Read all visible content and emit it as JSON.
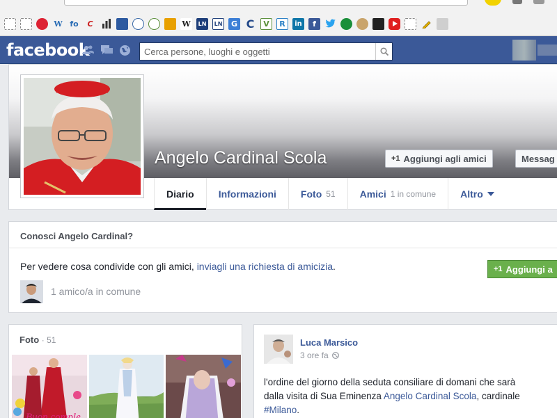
{
  "search": {
    "placeholder": "Cerca persone, luoghi e oggetti"
  },
  "facebook": {
    "logo": "facebook"
  },
  "bookmarks": [
    "W",
    "fo",
    "C",
    "W",
    "LN",
    "LN",
    "G",
    "C",
    "V",
    "R",
    "in",
    "f"
  ],
  "profile": {
    "name": "Angelo Cardinal Scola",
    "add_friend": "Aggiungi agli amici",
    "message": "Messag"
  },
  "tabs": [
    {
      "label": "Diario",
      "count": ""
    },
    {
      "label": "Informazioni",
      "count": ""
    },
    {
      "label": "Foto",
      "count": "51"
    },
    {
      "label": "Amici",
      "count": "1 in comune"
    },
    {
      "label": "Altro",
      "count": ""
    }
  ],
  "know": {
    "title": "Conosci Angelo Cardinal?",
    "text_prefix": "Per vedere cosa condivide con gli amici, ",
    "link": "inviagli una richiesta di amicizia",
    "text_suffix": ".",
    "button": "Aggiungi a",
    "mutual": "1 amico/a in comune"
  },
  "photos": {
    "title": "Foto",
    "count": "51",
    "caption_partial": "Buon comple"
  },
  "post": {
    "author": "Luca Marsico",
    "time": "3 ore fa",
    "line1": "l'ordine del giorno della seduta consiliare di domani che sarà",
    "line2_prefix": "dalla visita di Sua Eminenza ",
    "line2_link": "Angelo Cardinal Scola",
    "line2_suffix": ", cardinale",
    "hashtag": "#Milano",
    "hashtag_suffix": "."
  },
  "colors": {
    "fb_blue": "#3b5998",
    "link": "#3b5998",
    "green_button": "#6ab04c"
  }
}
